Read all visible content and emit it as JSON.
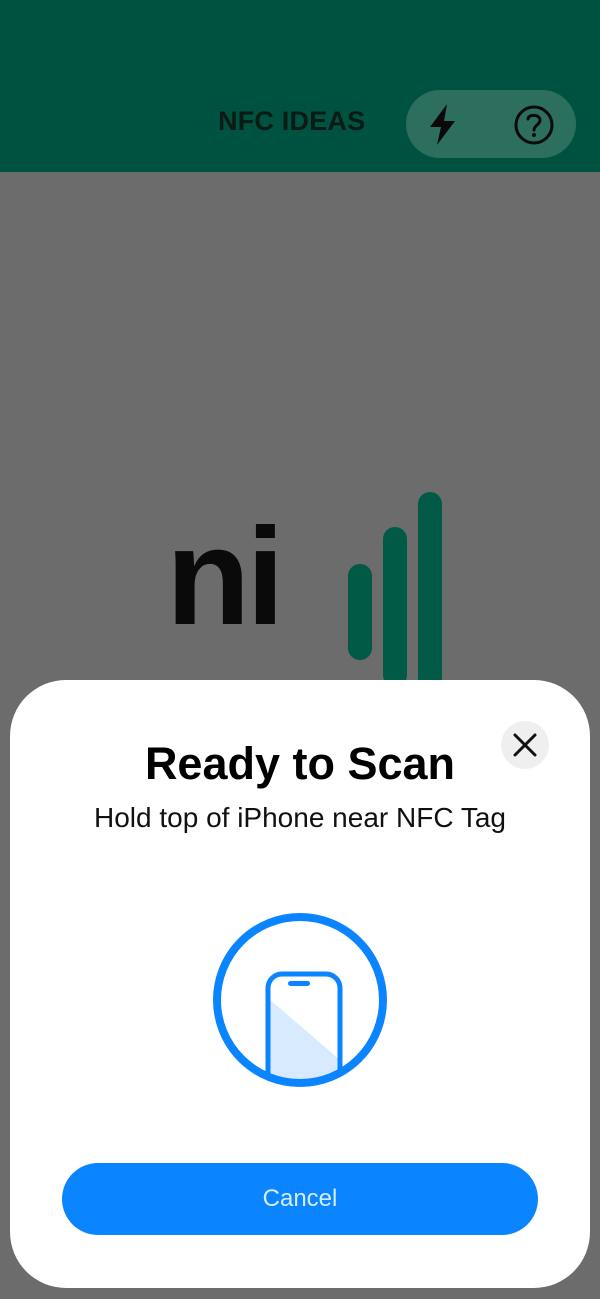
{
  "header": {
    "title": "NFC IDEAS",
    "buttons": [
      {
        "name": "flash",
        "icon": "lightning-bolt-icon"
      },
      {
        "name": "help",
        "icon": "question-circle-icon"
      }
    ],
    "background_color": "#005240"
  },
  "logo": {
    "text": "ni",
    "icon": "signal-bars-icon",
    "bars_color": "#005a45"
  },
  "scan_sheet": {
    "title": "Ready to Scan",
    "subtitle": "Hold top of iPhone near NFC Tag",
    "close_icon": "close-icon",
    "graphic_icon": "phone-scan-icon",
    "cancel_label": "Cancel",
    "accent_color": "#0a84ff"
  }
}
